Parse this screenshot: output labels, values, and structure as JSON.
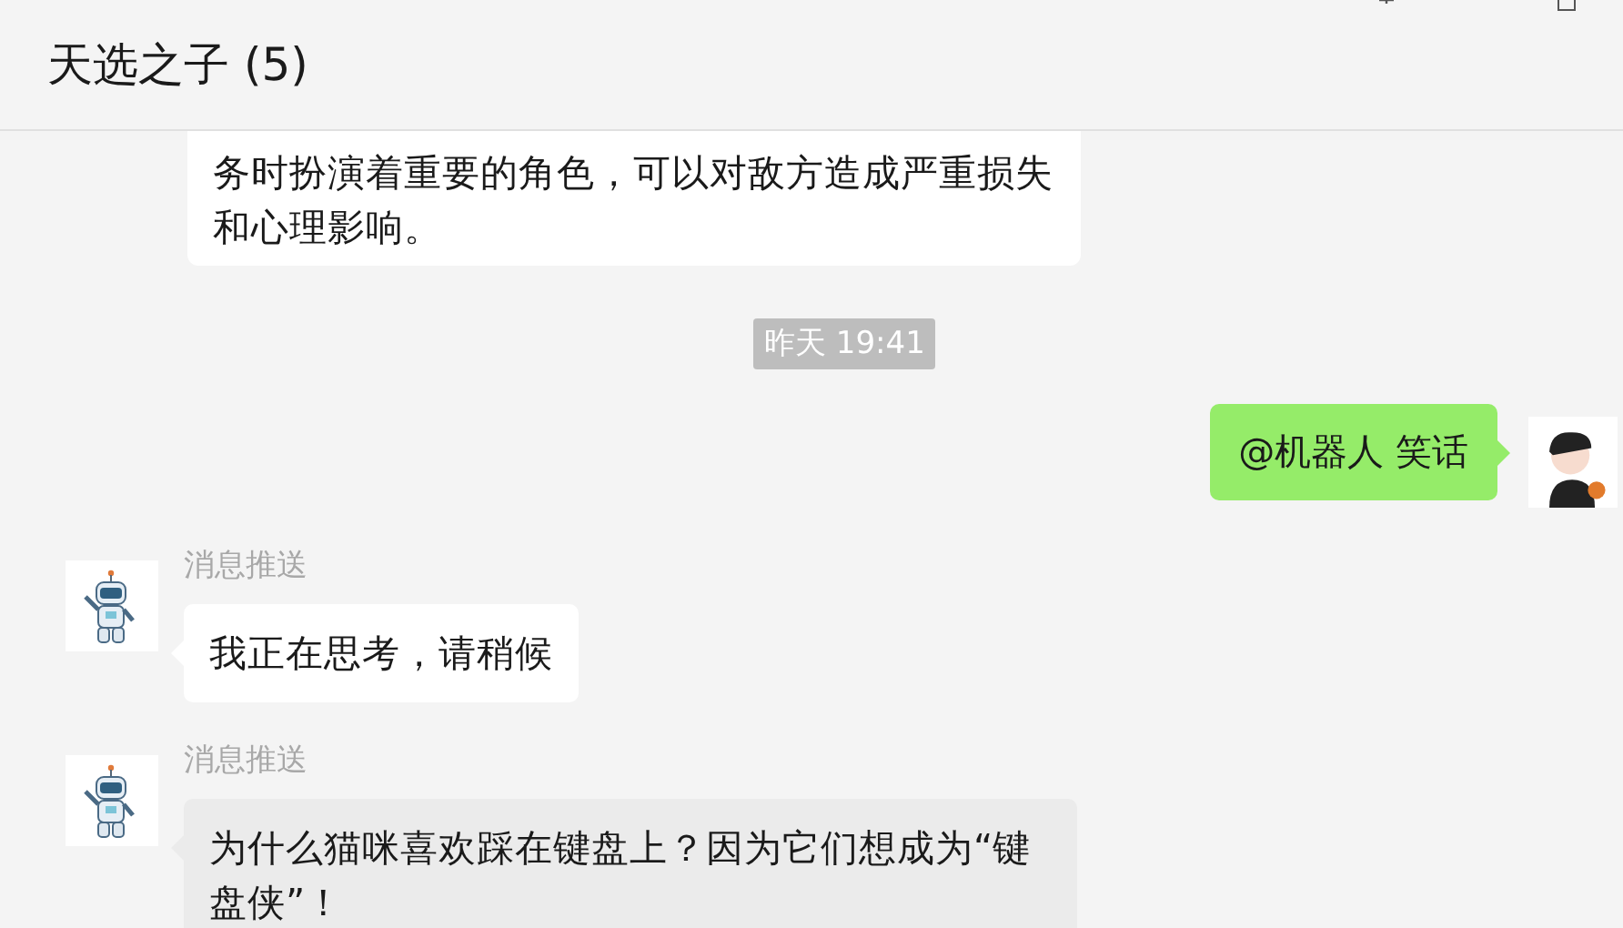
{
  "window": {
    "title": "天选之子 (5)"
  },
  "messages": [
    {
      "kind": "incoming",
      "text": "务时扮演着重要的角色，可以对敌方造成严重损失和心理影响。",
      "highlighted": false
    },
    {
      "kind": "time",
      "text": "昨天 19:41"
    },
    {
      "kind": "outgoing",
      "text": "@机器人 笑话"
    },
    {
      "kind": "incoming",
      "sender": "消息推送",
      "text": "我正在思考，请稍候",
      "highlighted": false
    },
    {
      "kind": "incoming",
      "sender": "消息推送",
      "text": "为什么猫咪喜欢踩在键盘上？因为它们想成为“键盘侠”！",
      "highlighted": true
    }
  ]
}
